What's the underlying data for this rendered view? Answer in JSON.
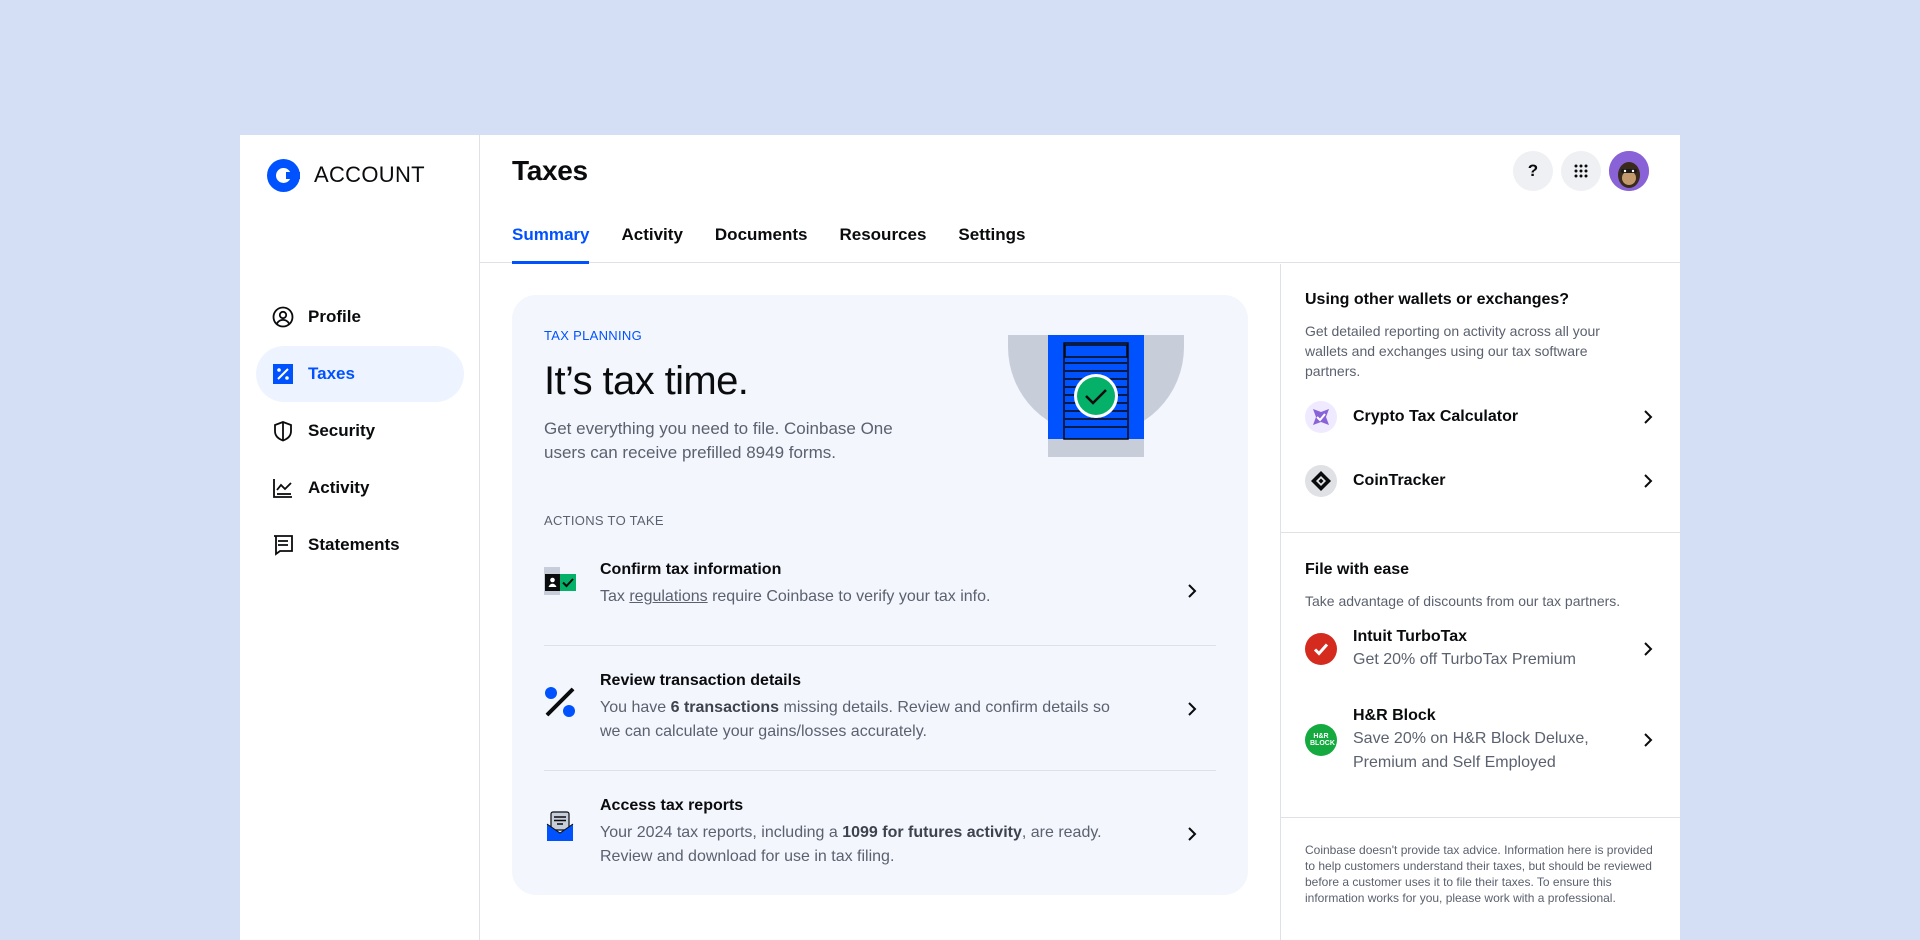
{
  "sidebar": {
    "brand": "ACCOUNT",
    "items": [
      {
        "label": "Profile",
        "icon": "user-circle-icon"
      },
      {
        "label": "Taxes",
        "icon": "percent-square-icon",
        "active": true
      },
      {
        "label": "Security",
        "icon": "shield-icon"
      },
      {
        "label": "Activity",
        "icon": "chart-icon"
      },
      {
        "label": "Statements",
        "icon": "receipt-icon"
      }
    ]
  },
  "header": {
    "title": "Taxes",
    "help_label": "?",
    "tabs": [
      "Summary",
      "Activity",
      "Documents",
      "Resources",
      "Settings"
    ],
    "active_tab": "Summary"
  },
  "planning": {
    "eyebrow": "TAX PLANNING",
    "title": "It’s tax time.",
    "subtitle": "Get everything you need to file. Coinbase One users can receive prefilled 8949 forms.",
    "actions_label": "ACTIONS TO TAKE",
    "actions": [
      {
        "title": "Confirm tax information",
        "desc_pre": "Tax ",
        "desc_link": "regulations",
        "desc_post": " require Coinbase to verify your tax info."
      },
      {
        "title": "Review transaction details",
        "desc_pre": "You have ",
        "desc_bold": "6 transactions",
        "desc_post": " missing details. Review and confirm details so we can calculate your gains/losses accurately."
      },
      {
        "title": "Access tax reports",
        "desc_pre": "Your 2024 tax reports, including a ",
        "desc_bold": "1099 for futures activity",
        "desc_post": ", are ready. Review and download for use in tax filing."
      }
    ]
  },
  "wallets": {
    "title": "Using other wallets or exchanges?",
    "desc": "Get detailed reporting on activity across all your wallets and exchanges using our tax software partners.",
    "partners": [
      {
        "name": "Crypto Tax Calculator"
      },
      {
        "name": "CoinTracker"
      }
    ]
  },
  "file_ease": {
    "title": "File with ease",
    "desc": "Take advantage of discounts from our tax partners.",
    "partners": [
      {
        "name": "Intuit TurboTax",
        "sub": "Get 20% off TurboTax Premium"
      },
      {
        "name": "H&R Block",
        "sub": "Save 20% on H&R Block Deluxe, Premium and Self Employed",
        "logo_text": "H&R BLOCK"
      }
    ]
  },
  "disclaimer": "Coinbase doesn't provide tax advice. Information here is provided to help customers understand their taxes, but should be reviewed before a customer uses it to file their taxes. To ensure this information works for you, please work with a professional.",
  "colors": {
    "accent": "#0052ff",
    "background": "#d4dff6",
    "card": "#f3f6fd",
    "turbotax": "#d52b1e",
    "hrblock": "#14aa40"
  }
}
